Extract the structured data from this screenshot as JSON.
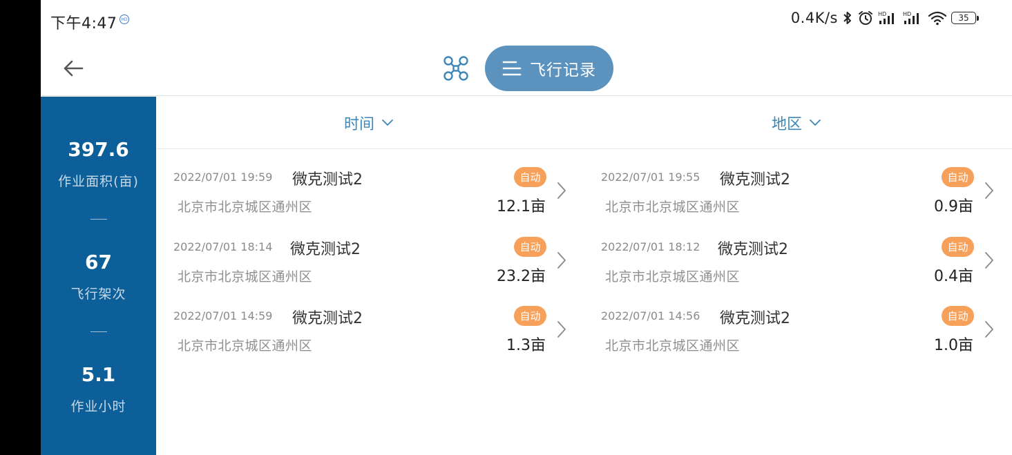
{
  "status_bar": {
    "time": "下午4:47",
    "net_speed": "0.4K/s",
    "battery": "35"
  },
  "header": {
    "back_icon": "arrow-left-icon",
    "drone_icon": "drone-icon",
    "tab_icon": "menu-lines-icon",
    "tab_label": "飞行记录"
  },
  "stats": {
    "area_value": "397.6",
    "area_label": "作业面积(亩)",
    "flights_value": "67",
    "flights_label": "飞行架次",
    "hours_value": "5.1",
    "hours_label": "作业小时"
  },
  "filters": {
    "time_label": "时间",
    "region_label": "地区"
  },
  "records": [
    {
      "date": "2022/07/01 19:59",
      "name": "微克测试2",
      "address": "北京市北京城区通州区",
      "mode": "自动",
      "area": "12.1亩"
    },
    {
      "date": "2022/07/01 19:55",
      "name": "微克测试2",
      "address": "北京市北京城区通州区",
      "mode": "自动",
      "area": "0.9亩"
    },
    {
      "date": "2022/07/01 18:14",
      "name": "微克测试2",
      "address": "北京市北京城区通州区",
      "mode": "自动",
      "area": "23.2亩"
    },
    {
      "date": "2022/07/01 18:12",
      "name": "微克测试2",
      "address": "北京市北京城区通州区",
      "mode": "自动",
      "area": "0.4亩"
    },
    {
      "date": "2022/07/01 14:59",
      "name": "微克测试2",
      "address": "北京市北京城区通州区",
      "mode": "自动",
      "area": "1.3亩"
    },
    {
      "date": "2022/07/01 14:56",
      "name": "微克测试2",
      "address": "北京市北京城区通州区",
      "mode": "自动",
      "area": "1.0亩"
    }
  ],
  "colors": {
    "sidebar": "#0c5f98",
    "accent": "#3c86b8",
    "pill": "#5b93be",
    "badge": "#f7a05a"
  }
}
